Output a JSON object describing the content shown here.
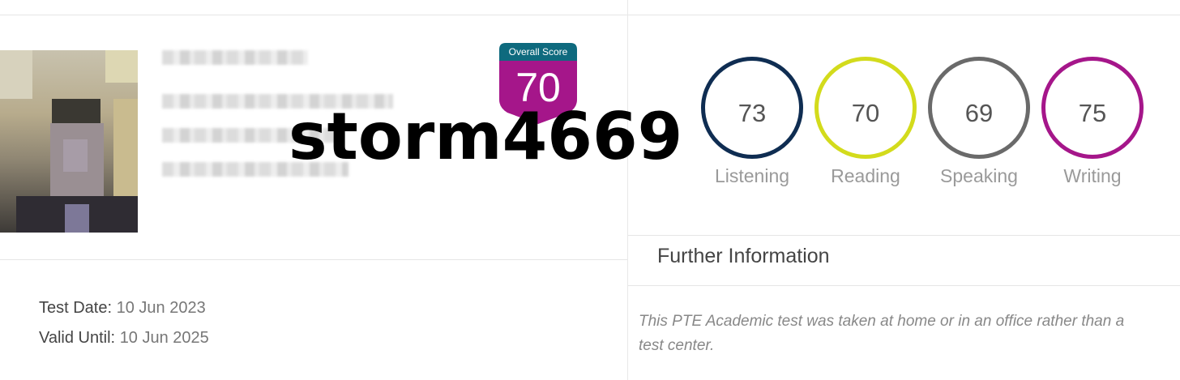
{
  "overall": {
    "label": "Overall Score",
    "score": "70",
    "colors": {
      "header": "#0e6a7e",
      "body": "#a5168a"
    }
  },
  "watermark": "storm4669",
  "skills": [
    {
      "name": "Listening",
      "score": "73",
      "color": "#0f2d52"
    },
    {
      "name": "Reading",
      "score": "70",
      "color": "#d3db1c"
    },
    {
      "name": "Speaking",
      "score": "69",
      "color": "#6a6a6a"
    },
    {
      "name": "Writing",
      "score": "75",
      "color": "#a5168a"
    }
  ],
  "further": {
    "title": "Further Information",
    "line1": "This PTE Academic test was taken at home or in an office rather than a",
    "line2": "test center."
  },
  "dates": {
    "test_date_label": "Test Date:",
    "test_date_value": "10 Jun 2023",
    "valid_until_label": "Valid Until:",
    "valid_until_value": "10 Jun 2025"
  }
}
